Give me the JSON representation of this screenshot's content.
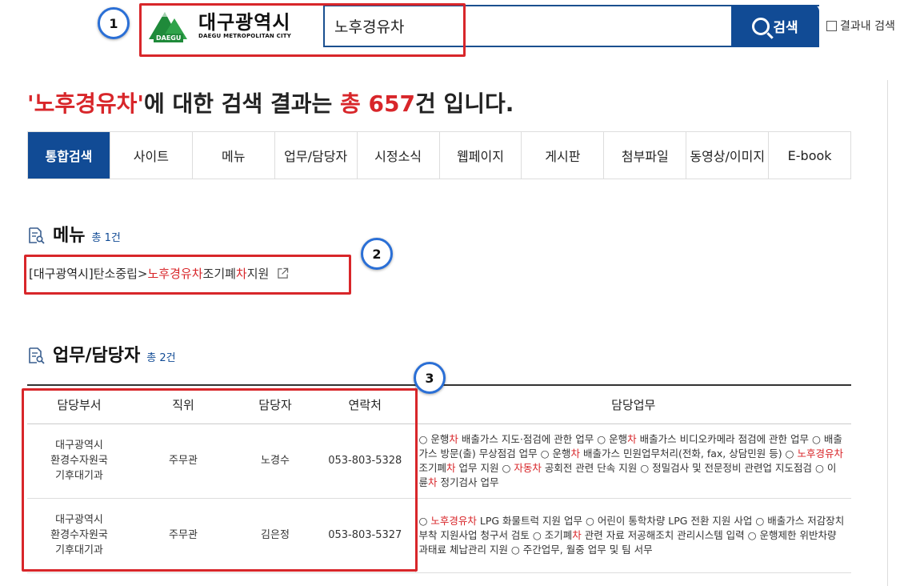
{
  "header": {
    "logo_badge": "DAEGU",
    "logo_kr": "대구광역시",
    "logo_en": "DAEGU METROPOLITAN CITY",
    "search_value": "노후경유차",
    "search_button": "검색",
    "within_label": "결과내 검색"
  },
  "markers": [
    "1",
    "2",
    "3"
  ],
  "result": {
    "quote_open": "'",
    "keyword": "노후경유차",
    "quote_close": "'",
    "mid": "에 대한 검색 결과는 ",
    "total_label": "총 657",
    "end": "건 입니다."
  },
  "tabs": [
    {
      "label": "통합검색",
      "active": true
    },
    {
      "label": "사이트"
    },
    {
      "label": "메뉴"
    },
    {
      "label": "업무/담당자"
    },
    {
      "label": "시정소식"
    },
    {
      "label": "웹페이지"
    },
    {
      "label": "게시판"
    },
    {
      "label": "첨부파일"
    },
    {
      "label": "동영상/이미지"
    },
    {
      "label": "E-book"
    }
  ],
  "menu_section": {
    "title": "메뉴",
    "count": "총 1건",
    "item": {
      "prefix": "[대구광역시]",
      "path": " 탄소중립>",
      "hit1": "노후경유차",
      "mid": " 조기폐",
      "hit2": "차",
      "tail": " 지원"
    }
  },
  "staff_section": {
    "title": "업무/담당자",
    "count": "총 2건",
    "columns": [
      "담당부서",
      "직위",
      "담당자",
      "연락처",
      "담당업무"
    ],
    "rows": [
      {
        "dept": [
          "대구광역시",
          "환경수자원국",
          "기후대기과"
        ],
        "position": "주무관",
        "name": "노경수",
        "phone": "053-803-5328",
        "duty": [
          {
            "t": "○ 운행"
          },
          {
            "t": "차",
            "hl": true
          },
          {
            "t": " 배출가스 지도·점검에 관한 업무 ○ 운행"
          },
          {
            "t": "차",
            "hl": true
          },
          {
            "t": " 배출가스 비디오카메라 점검에 관한 업무 ○ 배출가스 방문(출) 무상점검 업무 ○ 운행"
          },
          {
            "t": "차",
            "hl": true
          },
          {
            "t": " 배출가스 민원업무처리(전화, fax, 상담민원 등) ○ "
          },
          {
            "t": "노후경유차",
            "hl": true
          },
          {
            "t": " 조기폐"
          },
          {
            "t": "차",
            "hl": true
          },
          {
            "t": " 업무 지원 ○ "
          },
          {
            "t": "자동차",
            "hl": true
          },
          {
            "t": " 공회전 관련 단속 지원 ○ 정밀검사 및 전문정비 관련업 지도점검 ○ 이륜"
          },
          {
            "t": "차",
            "hl": true
          },
          {
            "t": " 정기검사 업무"
          }
        ]
      },
      {
        "dept": [
          "대구광역시",
          "환경수자원국",
          "기후대기과"
        ],
        "position": "주무관",
        "name": "김은정",
        "phone": "053-803-5327",
        "duty": [
          {
            "t": "○ "
          },
          {
            "t": "노후경유차",
            "hl": true
          },
          {
            "t": " LPG 화물트럭 지원 업무 ○ 어린이 통학차량 LPG 전환 지원 사업 ○ 배출가스 저감장치부착 지원사업 청구서 검토 ○ 조기폐"
          },
          {
            "t": "차",
            "hl": true
          },
          {
            "t": " 관련 자료 저공해조치 관리시스템 입력 ○ 운행제한 위반차량 과태료 체납관리 지원 ○ 주간업무, 월중 업무 및 팀 서무"
          }
        ]
      }
    ]
  },
  "colors": {
    "accent": "#114b95",
    "highlight": "#d8262a",
    "annotation_frame": "#d8262a",
    "annotation_circle": "#2a6fd6"
  }
}
